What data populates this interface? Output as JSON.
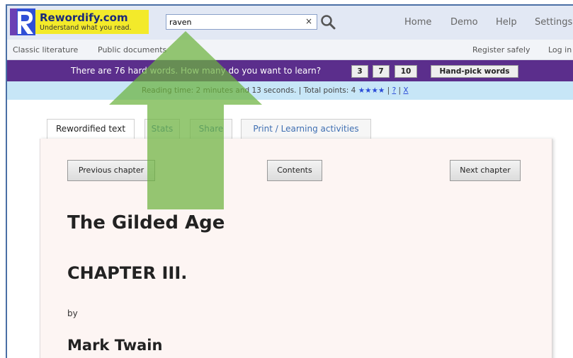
{
  "header": {
    "brand_name": "Rewordify.com",
    "brand_tagline": "Understand what you read.",
    "search": {
      "value": "raven",
      "clear_label": "×"
    },
    "nav": [
      "Home",
      "Demo",
      "Help",
      "Settings"
    ]
  },
  "subnav": {
    "left": [
      "Classic literature",
      "Public documents"
    ],
    "right": [
      "Register safely",
      "Log in"
    ]
  },
  "words_bar": {
    "text": "There are 76 hard words. How many do you want to learn?",
    "options": [
      "3",
      "7",
      "10"
    ],
    "hand_pick_label": "Hand-pick words"
  },
  "reading_bar": {
    "text": "Reading time: 2 minutes and 13 seconds. | Total points: 4",
    "stars": "★★★★",
    "sep1": " | ",
    "link1": "?",
    "sep2": " | ",
    "link2": "X"
  },
  "tabs": [
    "Rewordified text",
    "Stats",
    "Share",
    "Print / Learning activities"
  ],
  "chapter_nav": {
    "previous": "Previous chapter",
    "contents": "Contents",
    "next": "Next chapter"
  },
  "document": {
    "title": "The Gilded Age",
    "chapter": "CHAPTER III.",
    "by": "by",
    "author": "Mark Twain"
  },
  "colors": {
    "purple_bar": "#5b2e8c",
    "reading_bar": "#c7e6f7",
    "brand_yellow": "#f3ea2a",
    "arrow_green": "#6cb33f"
  }
}
